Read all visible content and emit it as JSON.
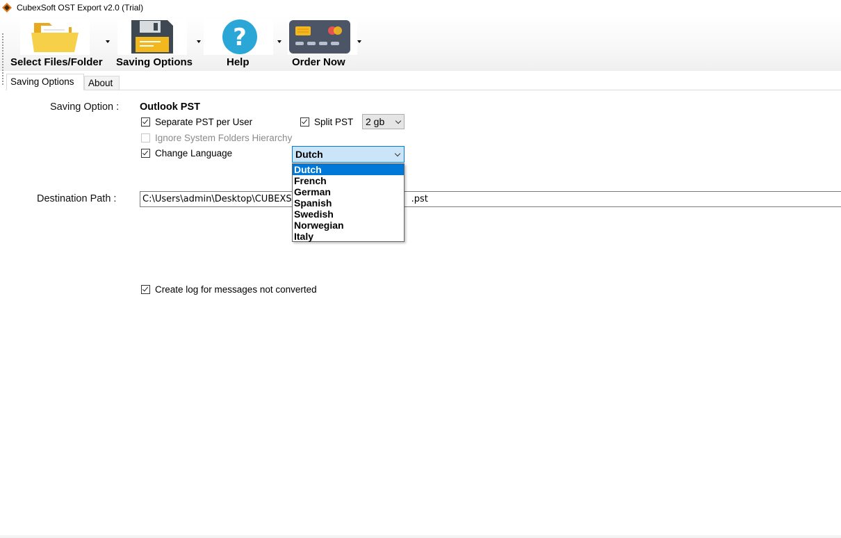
{
  "window": {
    "title": "CubexSoft OST Export v2.0 (Trial)"
  },
  "ribbon": {
    "select_files": "Select Files/Folder",
    "saving_options": "Saving Options",
    "help": "Help",
    "order_now": "Order Now"
  },
  "tabs": [
    "Saving Options",
    "About"
  ],
  "form": {
    "saving_option_label": "Saving Option :",
    "saving_option_value": "Outlook PST",
    "separate_pst": {
      "label": "Separate PST per User",
      "checked": true
    },
    "split_pst": {
      "label": "Split PST",
      "checked": true,
      "size": "2 gb"
    },
    "ignore_folders": {
      "label": "Ignore System Folders Hierarchy",
      "checked": false,
      "disabled": true
    },
    "change_language": {
      "label": "Change Language",
      "checked": true
    },
    "language": {
      "selected": "Dutch",
      "options": [
        "Dutch",
        "French",
        "German",
        "Spanish",
        "Swedish",
        "Norwegian",
        "Italy"
      ]
    },
    "destination_label": "Destination Path :",
    "destination_value_start": "C:\\Users\\admin\\Desktop\\CUBEXS",
    "destination_value_end": ".pst",
    "create_log": {
      "label": "Create log for messages not converted",
      "checked": true
    }
  },
  "colors": {
    "selection": "#0078d7",
    "combo_focus_bg": "#cce4f7",
    "folder_yellow": "#f5c63b",
    "help_blue": "#2aa7d6"
  },
  "icons": [
    "folder-icon",
    "floppy-disk-icon",
    "help-icon",
    "credit-card-icon"
  ]
}
